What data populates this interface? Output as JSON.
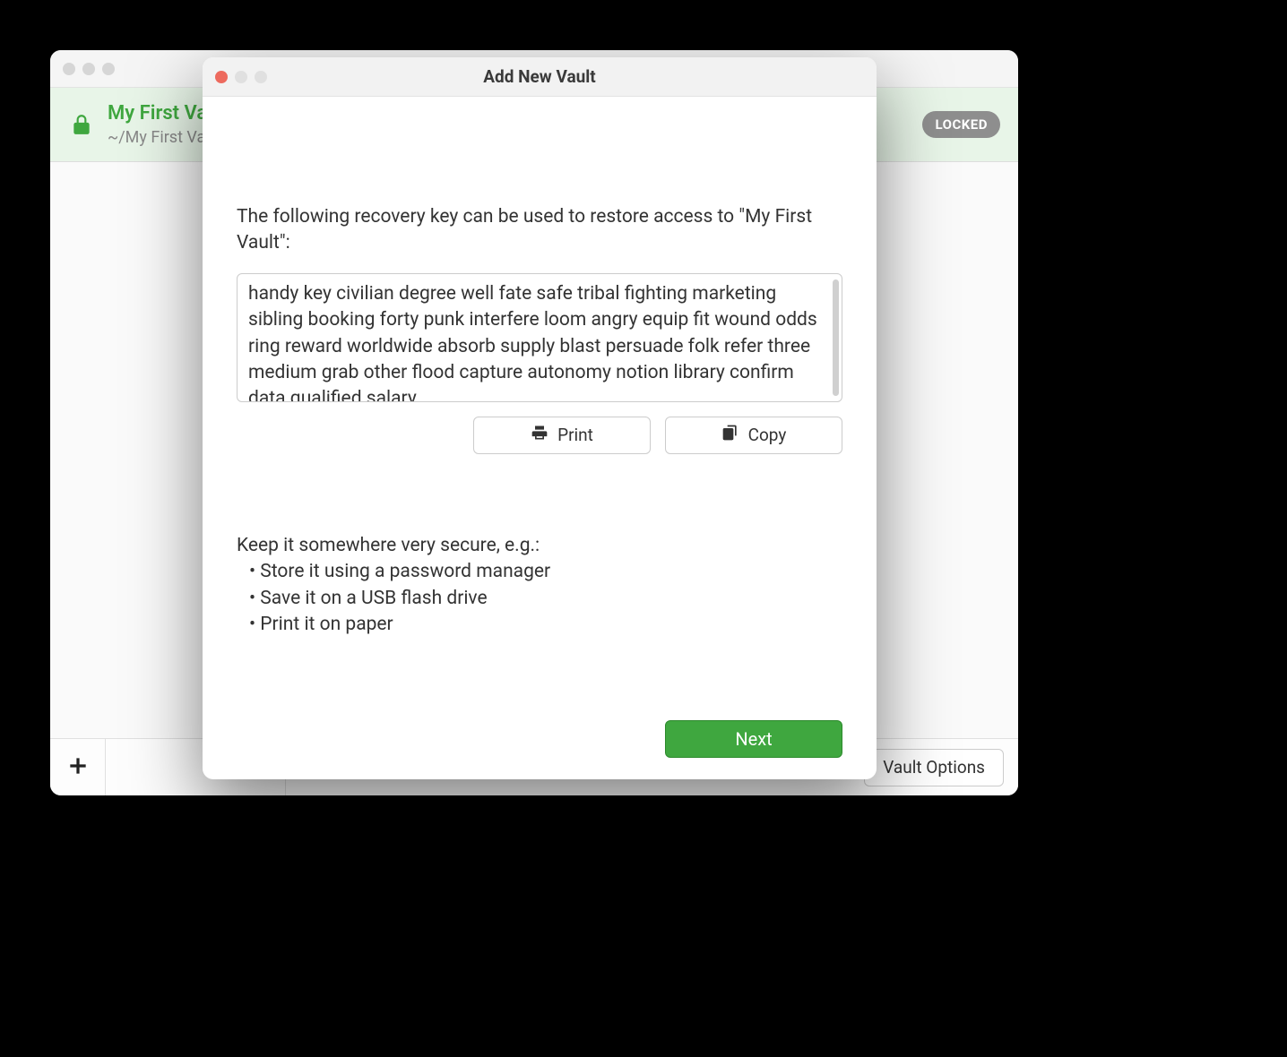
{
  "main": {
    "vault": {
      "name": "My First Vault",
      "path": "~/My First Vault",
      "status": "LOCKED"
    },
    "vault_options_label": "Vault Options"
  },
  "dialog": {
    "title": "Add New Vault",
    "intro": "The following recovery key can be used to restore access to \"My First Vault\":",
    "recovery_key": "handy key civilian degree well fate safe tribal fighting marketing sibling booking forty punk interfere loom angry equip fit wound odds ring reward worldwide absorb supply blast persuade folk refer three medium grab other flood capture autonomy notion library confirm data qualified salary",
    "print_label": "Print",
    "copy_label": "Copy",
    "advice_heading": "Keep it somewhere very secure, e.g.:",
    "advice_items": [
      "• Store it using a password manager",
      "• Save it on a USB flash drive",
      "• Print it on paper"
    ],
    "next_label": "Next"
  }
}
